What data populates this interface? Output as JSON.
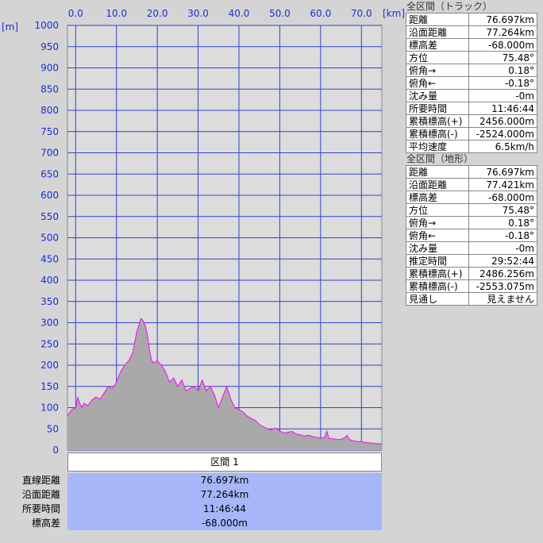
{
  "chart_data": {
    "type": "area",
    "x_unit": "[km]",
    "y_unit": "[m]",
    "xlim": [
      -2,
      75
    ],
    "ylim": [
      0,
      1000
    ],
    "x_ticks": [
      0,
      10,
      20,
      30,
      40,
      50,
      60,
      70
    ],
    "x_tick_labels": [
      "0.0",
      "10.0",
      "20.0",
      "30.0",
      "40.0",
      "50.0",
      "60.0",
      "70.0"
    ],
    "y_ticks": [
      0,
      50,
      100,
      150,
      200,
      250,
      300,
      350,
      400,
      450,
      500,
      550,
      600,
      650,
      700,
      750,
      800,
      850,
      900,
      950,
      1000
    ],
    "grid": true,
    "colors": {
      "plot_bg": "#dcdcdc",
      "grid": "#3343c8",
      "terrain_fill": "#a9a9a9",
      "track_line": "#ff00ff",
      "axis_text": "#1a2fd1"
    },
    "series": [
      {
        "x": [
          -2,
          -1,
          0,
          0.5,
          1,
          1.5,
          2,
          3,
          4,
          5,
          6,
          7,
          8,
          9,
          10,
          11,
          12,
          13,
          14,
          14.5,
          15,
          15.5,
          16,
          16.5,
          17,
          17.5,
          18,
          18.5,
          19,
          20,
          21,
          22,
          23,
          24,
          25,
          26,
          27,
          28,
          29,
          30,
          31,
          32,
          33,
          34,
          35,
          36,
          37,
          38,
          39,
          40,
          41,
          42,
          43,
          44,
          45,
          46,
          47,
          48,
          49,
          50,
          51,
          52,
          53,
          54,
          55,
          56,
          57,
          58,
          59,
          60,
          61,
          61.5,
          62,
          63,
          64,
          65,
          66,
          66.5,
          67,
          68,
          69,
          70,
          71,
          72,
          73,
          74,
          75
        ],
        "y": [
          80,
          95,
          100,
          125,
          110,
          100,
          110,
          105,
          118,
          125,
          120,
          135,
          150,
          145,
          160,
          185,
          200,
          210,
          230,
          255,
          280,
          295,
          310,
          305,
          295,
          275,
          240,
          215,
          205,
          210,
          200,
          185,
          160,
          170,
          150,
          165,
          140,
          145,
          150,
          140,
          165,
          140,
          150,
          130,
          100,
          125,
          150,
          120,
          100,
          95,
          90,
          80,
          75,
          70,
          60,
          55,
          50,
          48,
          52,
          45,
          40,
          42,
          44,
          38,
          36,
          33,
          35,
          32,
          30,
          28,
          30,
          45,
          28,
          27,
          25,
          25,
          30,
          35,
          25,
          22,
          20,
          20,
          18,
          17,
          16,
          15,
          15
        ]
      }
    ]
  },
  "panel_track": {
    "title": "全区間（トラック）",
    "rows": [
      {
        "label": "距離",
        "value": "76.697km"
      },
      {
        "label": "沿面距離",
        "value": "77.264km"
      },
      {
        "label": "標高差",
        "value": "-68.000m"
      },
      {
        "label": "方位",
        "value": "75.48°"
      },
      {
        "label": "俯角→",
        "value": "0.18°"
      },
      {
        "label": "俯角←",
        "value": "-0.18°"
      },
      {
        "label": "沈み量",
        "value": "-0m"
      },
      {
        "label": "所要時間",
        "value": "11:46:44"
      },
      {
        "label": "累積標高(+)",
        "value": "2456.000m"
      },
      {
        "label": "累積標高(-)",
        "value": "-2524.000m"
      },
      {
        "label": "平均速度",
        "value": "6.5km/h"
      }
    ]
  },
  "panel_terrain": {
    "title": "全区間（地形）",
    "rows": [
      {
        "label": "距離",
        "value": "76.697km"
      },
      {
        "label": "沿面距離",
        "value": "77.421km"
      },
      {
        "label": "標高差",
        "value": "-68.000m"
      },
      {
        "label": "方位",
        "value": "75.48°"
      },
      {
        "label": "俯角→",
        "value": "0.18°"
      },
      {
        "label": "俯角←",
        "value": "-0.18°"
      },
      {
        "label": "沈み量",
        "value": "-0m"
      },
      {
        "label": "推定時間",
        "value": "29:52:44"
      },
      {
        "label": "累積標高(+)",
        "value": "2486.256m"
      },
      {
        "label": "累積標高(-)",
        "value": "-2553.075m"
      },
      {
        "label": "見通し",
        "value": "見えません"
      }
    ]
  },
  "section": {
    "header": "区間 1",
    "rows": [
      {
        "label": "直線距離",
        "value": "76.697km"
      },
      {
        "label": "沿面距離",
        "value": "77.264km"
      },
      {
        "label": "所要時間",
        "value": "11:46:44"
      },
      {
        "label": "標高差",
        "value": "-68.000m"
      }
    ]
  }
}
